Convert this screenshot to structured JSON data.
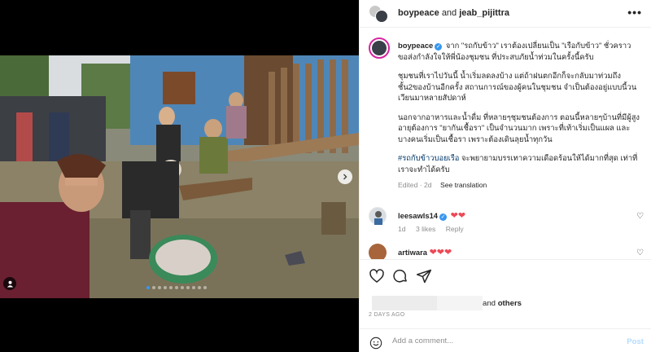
{
  "header": {
    "user1": "boypeace",
    "connector": "and",
    "user2": "jeab_pijittra",
    "more_glyph": "•••"
  },
  "caption": {
    "user": "boypeace",
    "paragraphs": [
      "จาก \"รถกับข้าว\" เราต้องเปลี่ยนเป็น \"เรือกับข้าว\" ชั่วคราว ขอส่งกำลังใจให้พี่น้องชุมชน ที่ประสบภัยน้ำท่วมในครั้งนี้ครับ",
      "ชุมชนที่เราไปวันนี้ น้ำเริ่มลดลงบ้าง แต่ถ้าฝนตกอีกก็จะกลับมาท่วมถึงชั้น2ของบ้านอีกครั้ง สถานการณ์ของผู้คนในชุมชน จำเป็นต้องอยู่แบบนี้วนเวียนมาหลายสัปดาห์",
      "นอกจากอาหารและน้ำดื่ม ที่หลายๆชุมชนต้องการ ตอนนี้หลายๆบ้านที่มีผู้สูงอายุต้องการ \"ยากันเชื้อรา\" เป็นจำนวนมาก เพราะที่เท้าเริ่มเป็นแผล และบางคนเริ่มเป็นเชื้อรา เพราะต้องเดินลุยน้ำทุกวัน"
    ],
    "hashtag": "#รถกับข้าวบอยเรือ",
    "last_text": " จะพยายามบรรเทาความเดือดร้อนให้ได้มากที่สุด เท่าที่เราจะทำได้ครับ",
    "edited": "Edited · 2d",
    "see_translation": "See translation"
  },
  "comments": [
    {
      "user": "leesawls14",
      "text": "❤❤",
      "time": "1d",
      "likes": "3 likes",
      "reply": "Reply"
    },
    {
      "user": "artiwara",
      "text": "❤❤❤"
    }
  ],
  "likes": {
    "suffix_word": "and",
    "others": "others"
  },
  "posted": "2 DAYS AGO",
  "comment_box": {
    "placeholder": "Add a comment...",
    "post_label": "Post"
  },
  "carousel": {
    "count": 11,
    "active_index": 0
  },
  "colors": {
    "verified": "#3897f0",
    "heart": "#ed4956",
    "post_disabled": "#b3dbff",
    "hashtag": "#00376b"
  },
  "icons": [
    "next-arrow-icon",
    "user-tag-icon",
    "verified-icon",
    "heart-icon",
    "comment-icon",
    "share-icon",
    "smile-icon",
    "more-icon"
  ]
}
